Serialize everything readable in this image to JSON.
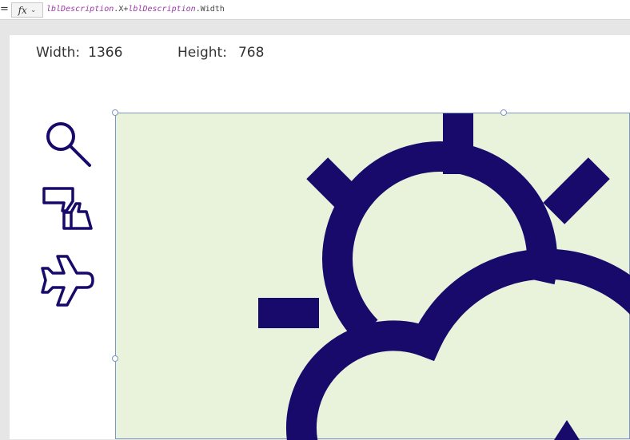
{
  "formula_bar": {
    "equals": "=",
    "fx_label": "fx",
    "chevron": "⌄",
    "formula": {
      "obj1": "lblDescription",
      "dot1": ".",
      "prop1": "X",
      "plus": "+",
      "obj2": "lblDescription",
      "dot2": ".",
      "prop2": "Width"
    }
  },
  "canvas": {
    "width_label": "Width:",
    "width_value": "1366",
    "height_label": "Height:",
    "height_value": "768"
  },
  "icons": {
    "icon1": "search-icon",
    "icon2": "like-dislike-icon",
    "icon3": "airplane-icon",
    "image": "partly-cloudy-day-icon"
  },
  "colors": {
    "icon_color": "#170a6b",
    "image_bg": "#e9f3dc",
    "selection": "#7b96c7",
    "formula_obj": "#9a3aa6"
  }
}
